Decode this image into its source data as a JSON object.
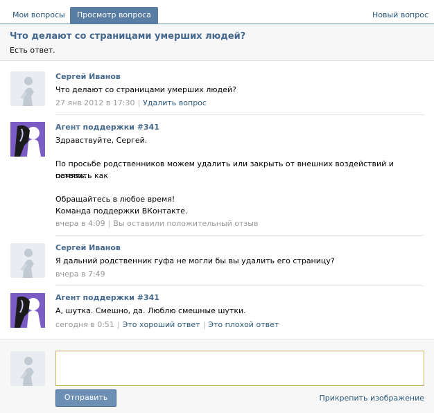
{
  "tabs": {
    "my_questions": "Мои вопросы",
    "view_question": "Просмотр вопроса",
    "new_question": "Новый вопрос"
  },
  "question": {
    "title": "Что делают со страницами умерших людей?",
    "status": "Есть ответ."
  },
  "messages": [
    {
      "author": "Сергей Иванов",
      "lines": [
        "Что делают со страницами умерших людей?"
      ],
      "time": "27 янв 2012 в 17:30",
      "actions": [
        "Удалить вопрос"
      ]
    },
    {
      "author": "Агент поддержки #341",
      "lines": [
        "Здравствуйте, Сергей.",
        "",
        "По просьбе родственников можем удалить или закрыть от внешних воздействий и оставить как",
        "память.",
        "",
        "Обращайтесь в любое время!",
        "Команда поддержки ВКонтакте."
      ],
      "time": "вчера в 4:09",
      "actions": [
        "Вы оставили положительный отзыв"
      ]
    },
    {
      "author": "Сергей Иванов",
      "lines": [
        "Я дальний родственник гуфа не могли бы вы удалить его страницу?"
      ],
      "time": "вчера в 7:49",
      "actions": []
    },
    {
      "author": "Агент поддержки #341",
      "lines": [
        "А, шутка. Смешно, да. Люблю смешные шутки."
      ],
      "time": "сегодня в 0:51",
      "actions": [
        "Это хороший ответ",
        "Это плохой ответ"
      ]
    }
  ],
  "reply": {
    "send_label": "Отправить",
    "attach_label": "Прикрепить изображение",
    "input_value": ""
  },
  "colors": {
    "accent": "#597da3",
    "link": "#2b587a",
    "author": "#45688e",
    "agent_avatar_bg": "#7b5bc4"
  },
  "icons": {
    "user_avatar": "default-user-silhouette-icon",
    "agent_avatar": "support-agent-avatar-icon"
  }
}
